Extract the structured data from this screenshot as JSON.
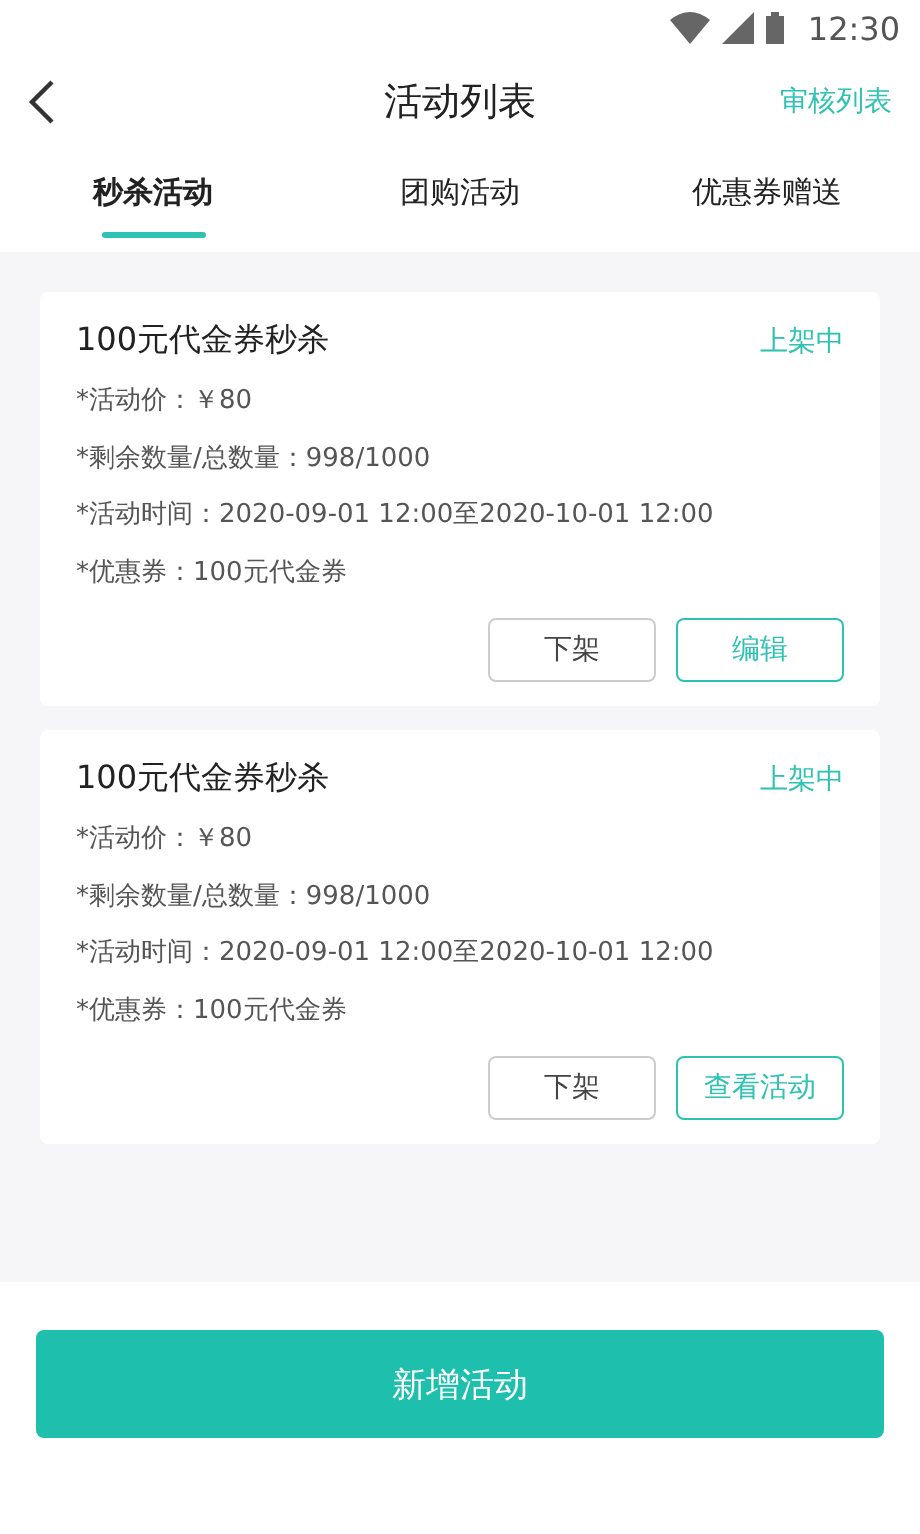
{
  "status_bar": {
    "time": "12:30"
  },
  "header": {
    "title": "活动列表",
    "action": "审核列表"
  },
  "tabs": [
    {
      "label": "秒杀活动",
      "selected": true
    },
    {
      "label": "团购活动",
      "selected": false
    },
    {
      "label": "优惠券赠送",
      "selected": false
    }
  ],
  "cards": [
    {
      "title": "100元代金券秒杀",
      "status": "上架中",
      "lines": [
        "*活动价：￥80",
        "*剩余数量/总数量：998/1000",
        "*活动时间：2020-09-01 12:00至2020-10-01 12:00",
        "*优惠券：100元代金券"
      ],
      "buttons": [
        {
          "label": "下架",
          "kind": "plain"
        },
        {
          "label": "编辑",
          "kind": "primary"
        }
      ]
    },
    {
      "title": "100元代金券秒杀",
      "status": "上架中",
      "lines": [
        "*活动价：￥80",
        "*剩余数量/总数量：998/1000",
        "*活动时间：2020-09-01 12:00至2020-10-01 12:00",
        "*优惠券：100元代金券"
      ],
      "buttons": [
        {
          "label": "下架",
          "kind": "plain"
        },
        {
          "label": "查看活动",
          "kind": "primary"
        }
      ]
    }
  ],
  "footer_button": "新增活动"
}
